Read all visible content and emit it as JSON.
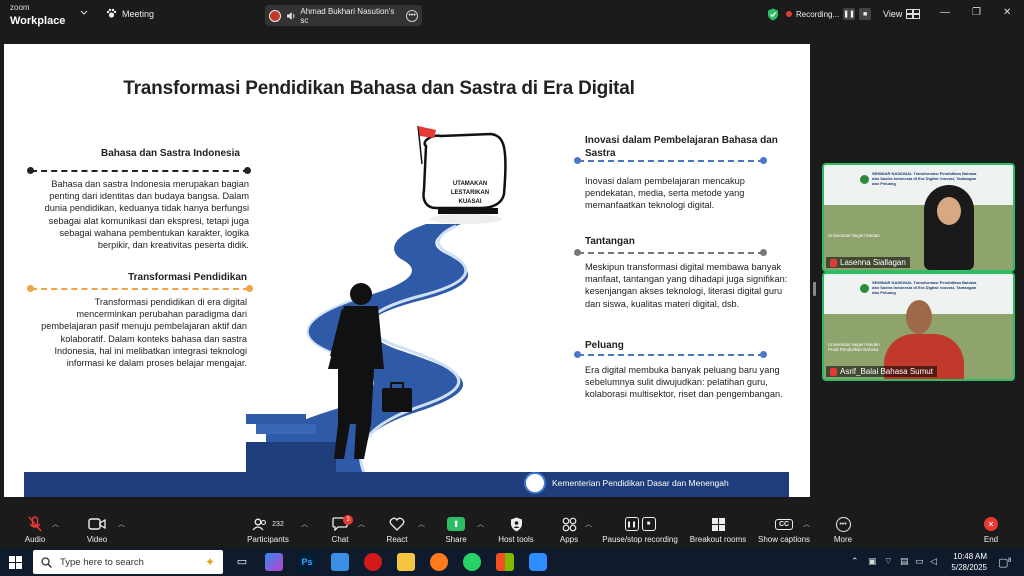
{
  "titlebar": {
    "brand_top": "zoom",
    "brand_bottom": "Workplace",
    "meeting_label": "Meeting",
    "sharing_label": "Ahmad Bukhari Nasution's sc",
    "recording_label": "Recording...",
    "view_label": "View"
  },
  "slide": {
    "title": "Transformasi Pendidikan Bahasa dan Sastra di Era Digital",
    "left": [
      {
        "heading": "Bahasa dan Sastra Indonesia",
        "body": "Bahasa dan sastra Indonesia merupakan bagian penting dari identitas dan budaya bangsa. Dalam dunia pendidikan, keduanya tidak hanya berfungsi sebagai alat komunikasi dan ekspresi, tetapi juga sebagai wahana pembentukan karakter, logika berpikir, dan kreativitas peserta didik."
      },
      {
        "heading": "Transformasi Pendidikan",
        "body": "Transformasi pendidikan di era digital mencerminkan perubahan paradigma dari pembelajaran pasif menuju pembelajaran aktif dan kolaboratif. Dalam konteks bahasa dan sastra Indonesia, hal ini melibatkan integrasi teknologi informasi ke dalam proses belajar mengajar."
      }
    ],
    "right": [
      {
        "heading": "Inovasi dalam Pembelajaran Bahasa dan Sastra",
        "body": "Inovasi dalam pembelajaran mencakup pendekatan, media, serta metode yang memanfaatkan teknologi digital."
      },
      {
        "heading": "Tantangan",
        "body": "Meskipun transformasi digital membawa banyak manfaat, tantangan yang dihadapi juga signifikan: kesenjangan akses teknologi, literasi digital guru dan siswa, kualitas materi digital, dsb."
      },
      {
        "heading": "Peluang",
        "body": "Era digital membuka banyak peluang baru yang sebelumnya sulit diwujudkan: pelatihan guru, kolaborasi multisektor, riset dan pengembangan."
      }
    ],
    "sign_lines": [
      "UTAMAKAN",
      "LESTARIKAN",
      "KUASAI"
    ],
    "footer": "Kementerian Pendidikan Dasar dan Menengah",
    "colors": {
      "title": "#222222",
      "left_line": "#222222",
      "orange_line": "#f0a44a",
      "blue_line": "#4a78c8",
      "gray_line": "#777777",
      "footer_bar": "#1f3d7a"
    }
  },
  "participants": [
    {
      "name": "Lasenna Siallagan",
      "banner": "SEMINAR NASIONAL Transformasi Pendidikan Bahasa dan Sastra Indonesia di Era Digital: Inovasi, Tantangan dan Peluang",
      "affiliation": "Universitas Negeri Medan"
    },
    {
      "name": "Asrif_Balai Bahasa Sumut",
      "banner": "SEMINAR NASIONAL Transformasi Pendidikan Bahasa dan Sastra Indonesia di Era Digital: Inovasi, Tantangan dan Peluang",
      "affiliation": "Universitas Negeri Medan Prodi Pendidikan Bahasa"
    }
  ],
  "toolbar": {
    "audio": "Audio",
    "video": "Video",
    "participants": "Participants",
    "participants_count": "232",
    "chat": "Chat",
    "chat_badge": "3",
    "react": "React",
    "share": "Share",
    "host_tools": "Host tools",
    "apps": "Apps",
    "pause_recording": "Pause/stop recording",
    "breakout": "Breakout rooms",
    "captions": "Show captions",
    "more": "More",
    "end": "End"
  },
  "taskbar": {
    "search_placeholder": "Type here to search",
    "time": "10:48 AM",
    "date": "5/28/2025",
    "notification_count": "8"
  }
}
